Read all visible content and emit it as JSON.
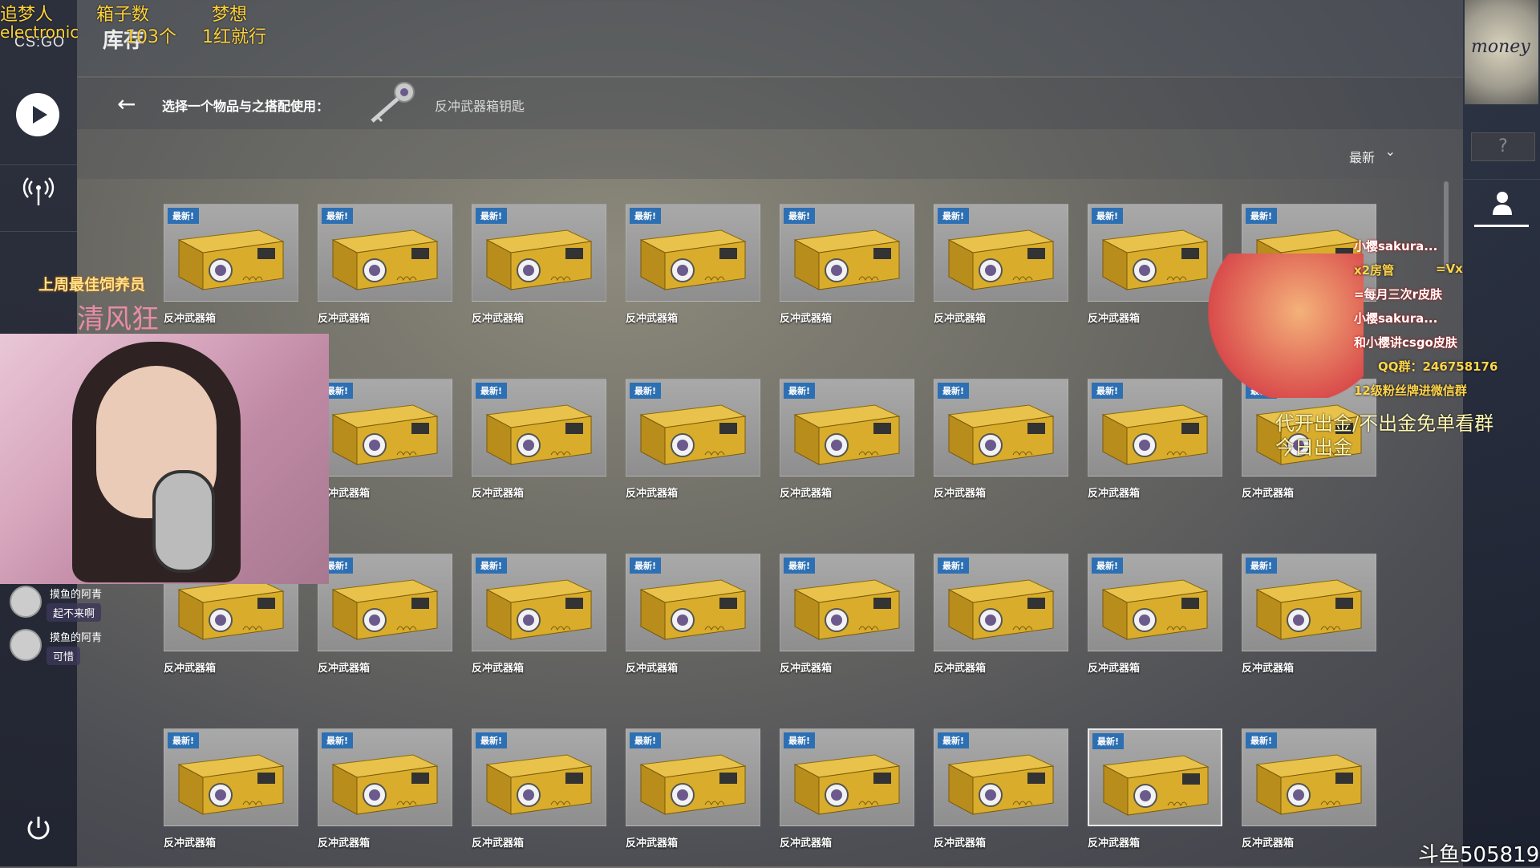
{
  "app": {
    "logo": "CS:GO",
    "page_title": "库存"
  },
  "subbar": {
    "back": "←",
    "prompt": "选择一个物品与之搭配使用：",
    "key_name": "反冲武器箱钥匙"
  },
  "sort": {
    "label": "最新",
    "chevron": "⌄"
  },
  "right_rail": {
    "emblem_text": "money",
    "help": "?"
  },
  "grid": {
    "badge": "最新!",
    "item_name": "反冲武器箱",
    "rows": 4,
    "cols": 8,
    "selected_index": 30,
    "case_color": "#d9ad2b"
  },
  "overlay": {
    "top_labels": [
      "追梦人",
      "箱子数",
      "梦想"
    ],
    "top_values": [
      "electronic",
      "103个",
      "1红就行"
    ],
    "best_feeder_label": "上周最佳饲养员",
    "best_feeder_name": "清风狂",
    "chat": [
      {
        "nick": "摸鱼的阿青",
        "text": "起不来啊"
      },
      {
        "nick": "摸鱼的阿青",
        "text": "可惜"
      }
    ],
    "right_lines": [
      "小樱sakura...",
      "x2房管",
      "=Vx",
      "=每月三次r皮肤",
      "小樱sakura...",
      "和小樱讲csgo皮肤",
      "QQ群：246758176",
      "12级粉丝牌进微信群"
    ],
    "big_line_1": "代开出金/不出金免单看群",
    "big_line_2": "今日出金",
    "watermark": "斗鱼505819"
  }
}
